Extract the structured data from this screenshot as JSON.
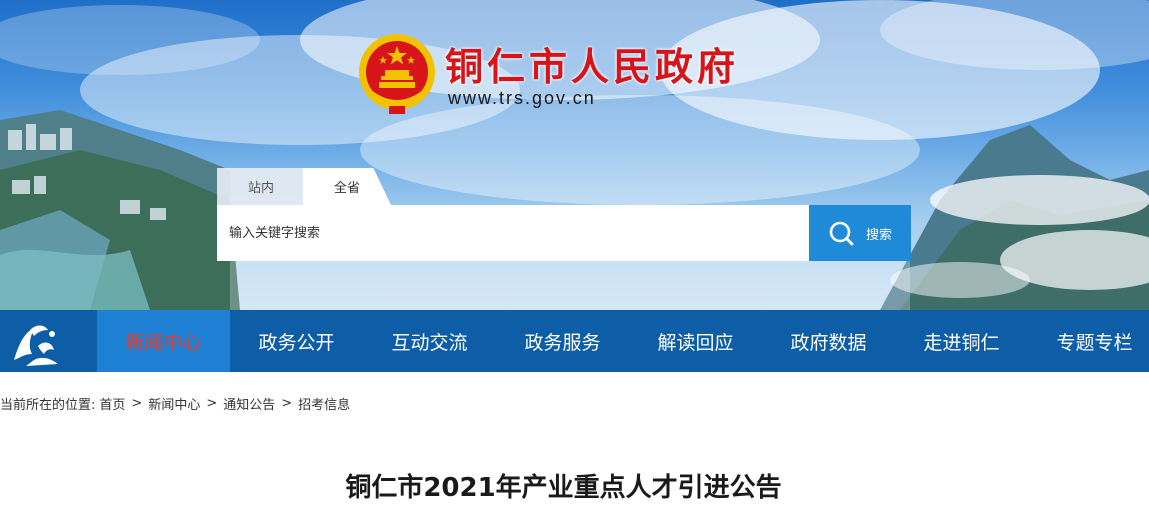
{
  "site": {
    "title": "铜仁市人民政府",
    "url": "www.trs.gov.cn"
  },
  "search": {
    "tabs": [
      {
        "label": "站内",
        "selected": false
      },
      {
        "label": "全省",
        "selected": true
      }
    ],
    "placeholder": "输入关键字搜索",
    "button_label": "搜索"
  },
  "nav": {
    "items": [
      {
        "label": "新闻中心",
        "active": true
      },
      {
        "label": "政务公开",
        "active": false
      },
      {
        "label": "互动交流",
        "active": false
      },
      {
        "label": "政务服务",
        "active": false
      },
      {
        "label": "解读回应",
        "active": false
      },
      {
        "label": "政府数据",
        "active": false
      },
      {
        "label": "走进铜仁",
        "active": false
      },
      {
        "label": "专题专栏",
        "active": false
      }
    ]
  },
  "breadcrumb": {
    "prefix": "当前所在的位置:",
    "items": [
      "首页",
      "新闻中心",
      "通知公告",
      "招考信息"
    ],
    "separator": ">"
  },
  "article": {
    "title": "铜仁市2021年产业重点人才引进公告"
  },
  "colors": {
    "nav_bg": "#0e5ea7",
    "nav_active_bg": "#1d80d3",
    "nav_active_text": "#e23b2e",
    "search_button": "#1f8ad8",
    "title_red": "#d7141a"
  },
  "icons": {
    "emblem": "national-emblem-icon",
    "search": "search-icon",
    "nav_logo": "city-logo-icon"
  }
}
